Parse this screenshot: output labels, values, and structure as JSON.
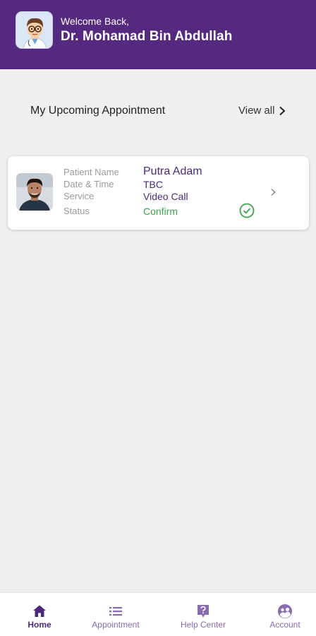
{
  "header": {
    "greeting": "Welcome Back,",
    "doctor_name": "Dr. Mohamad Bin Abdullah",
    "background_color": "#55297f"
  },
  "section": {
    "title": "My Upcoming Appointment",
    "view_all_label": "View all"
  },
  "appointment": {
    "labels": {
      "patient_name": "Patient Name",
      "date_time": "Date & Time",
      "service": "Service",
      "status": "Status"
    },
    "patient_name": "Putra Adam",
    "date_time": "TBC",
    "service": "Video Call",
    "status": "Confirm",
    "status_color": "#3aa54a",
    "status_icon": "check-circle-icon"
  },
  "tabbar": {
    "active": "home",
    "tabs": [
      {
        "id": "home",
        "label": "Home",
        "icon": "home-icon"
      },
      {
        "id": "appointment",
        "label": "Appointment",
        "icon": "list-icon"
      },
      {
        "id": "help",
        "label": "Help Center",
        "icon": "help-icon"
      },
      {
        "id": "account",
        "label": "Account",
        "icon": "account-icon"
      }
    ]
  },
  "colors": {
    "primary": "#55297f",
    "tab_inactive": "#8a6ab0",
    "background": "#efefef"
  }
}
